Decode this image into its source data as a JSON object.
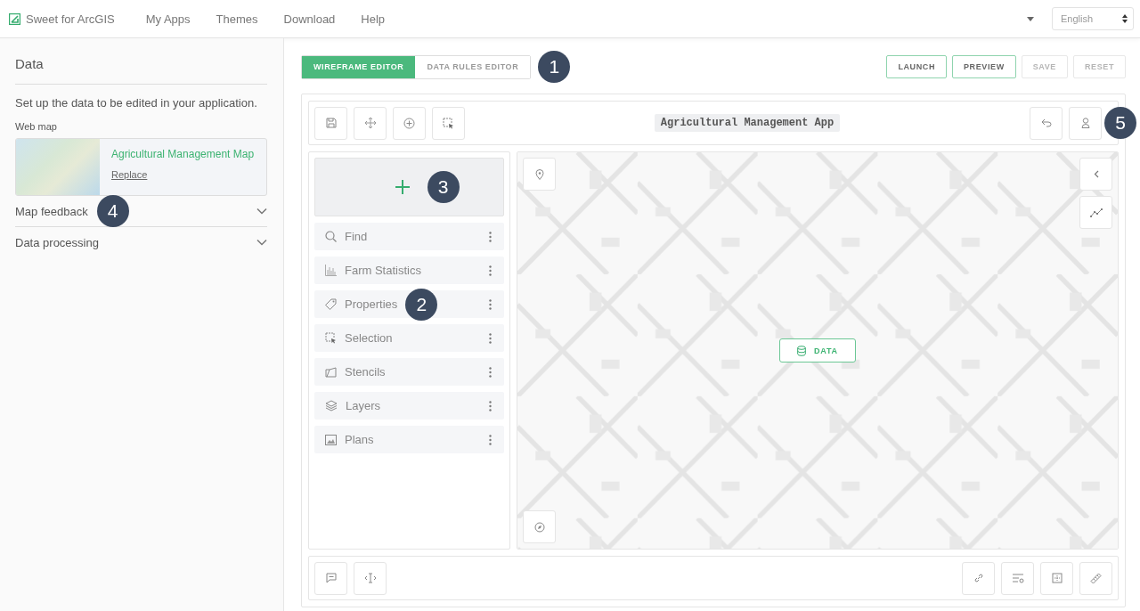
{
  "header": {
    "brand": "Sweet for ArcGIS",
    "nav": [
      "My Apps",
      "Themes",
      "Download",
      "Help"
    ],
    "language": "English"
  },
  "sidebar": {
    "title": "Data",
    "description": "Set up the data to be edited in your application.",
    "web_map_label": "Web map",
    "web_map": {
      "name": "Agricultural Management Map",
      "action": "Replace"
    },
    "sections": [
      {
        "label": "Map feedback",
        "expanded": false,
        "callout": "4"
      },
      {
        "label": "Data processing",
        "expanded": false
      }
    ]
  },
  "editor_tabs": [
    {
      "label": "WIREFRAME EDITOR",
      "selected": true
    },
    {
      "label": "DATA RULES EDITOR",
      "selected": false
    }
  ],
  "tabs_callout": "1",
  "actions": [
    {
      "label": "LAUNCH",
      "disabled": false
    },
    {
      "label": "PREVIEW",
      "disabled": false
    },
    {
      "label": "SAVE",
      "disabled": true
    },
    {
      "label": "RESET",
      "disabled": true
    }
  ],
  "app": {
    "title": "Agricultural Management App",
    "user_callout": "5",
    "add_callout": "3",
    "widgets": [
      {
        "kind": "search",
        "label": "Find"
      },
      {
        "kind": "chart",
        "label": "Farm Statistics"
      },
      {
        "kind": "tag",
        "label": "Properties",
        "callout": "2"
      },
      {
        "kind": "select",
        "label": "Selection"
      },
      {
        "kind": "stencil",
        "label": "Stencils"
      },
      {
        "kind": "layers",
        "label": "Layers"
      },
      {
        "kind": "image",
        "label": "Plans"
      }
    ],
    "map_button": "DATA"
  }
}
